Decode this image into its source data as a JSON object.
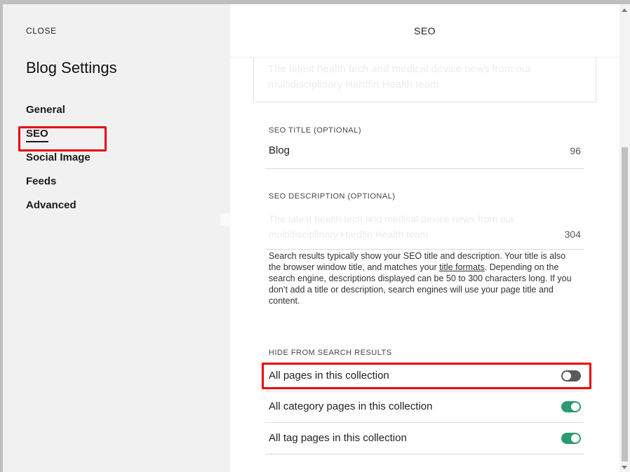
{
  "sidebar": {
    "close_label": "CLOSE",
    "title": "Blog Settings",
    "items": [
      {
        "label": "General",
        "active": false
      },
      {
        "label": "SEO",
        "active": true
      },
      {
        "label": "Social Image",
        "active": false
      },
      {
        "label": "Feeds",
        "active": false
      },
      {
        "label": "Advanced",
        "active": false
      }
    ]
  },
  "main": {
    "title": "SEO",
    "faded_text": "The latest health tech and medical device news from our multidisciplinary Hardfin Health team",
    "seo_title": {
      "label": "SEO TITLE (OPTIONAL)",
      "value": "Blog",
      "count": "96"
    },
    "seo_description": {
      "label": "SEO DESCRIPTION (OPTIONAL)",
      "value": "The latest health tech and medical device news from our multidisciplinary Hardfin Health team",
      "count": "304"
    },
    "help": {
      "part1": "Search results typically show your SEO title and description. Your title is also the browser window title, and matches your ",
      "link": "title formats",
      "part2": ". Depending on the search engine, descriptions displayed can be 50 to 300 characters long. If you don’t add a title or description, search engines will use your page title and content."
    },
    "hide_section": {
      "label": "HIDE FROM SEARCH RESULTS",
      "toggles": [
        {
          "label": "All pages in this collection",
          "on": false
        },
        {
          "label": "All category pages in this collection",
          "on": true
        },
        {
          "label": "All tag pages in this collection",
          "on": true
        }
      ]
    }
  },
  "colors": {
    "highlight": "#e8000b",
    "toggle_on": "#2b9a6e",
    "toggle_off": "#5a5a5a"
  }
}
